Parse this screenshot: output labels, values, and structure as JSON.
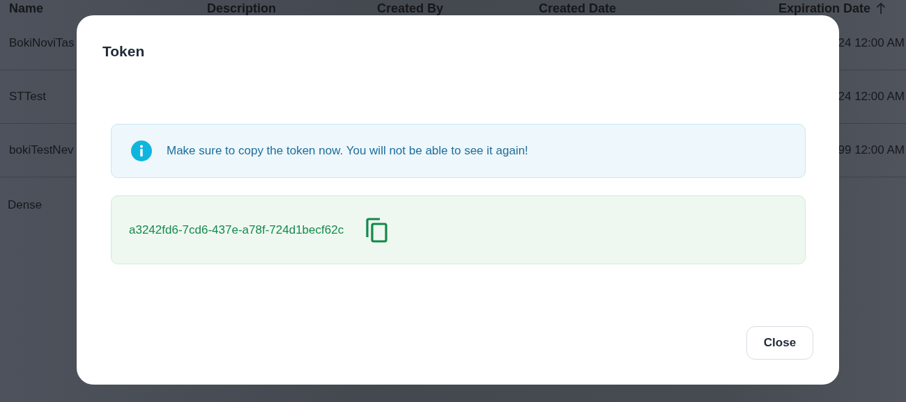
{
  "table": {
    "columns": [
      {
        "label": "Name"
      },
      {
        "label": "Description"
      },
      {
        "label": "Created By"
      },
      {
        "label": "Created Date"
      },
      {
        "label": "Expiration Date",
        "sorted": true
      }
    ],
    "rows": [
      {
        "name": "BokiNoviTas",
        "expiration": "24 12:00 AM"
      },
      {
        "name": "STTest",
        "expiration": "24 12:00 AM"
      },
      {
        "name": "bokiTestNev",
        "expiration": "99 12:00 AM"
      }
    ]
  },
  "dense_label": "Dense",
  "dialog": {
    "title": "Token",
    "alert": "Make sure to copy the token now. You will not be able to see it again!",
    "token": "a3242fd6-7cd6-437e-a78f-724d1becf62c",
    "buttons": [
      "Close"
    ]
  }
}
